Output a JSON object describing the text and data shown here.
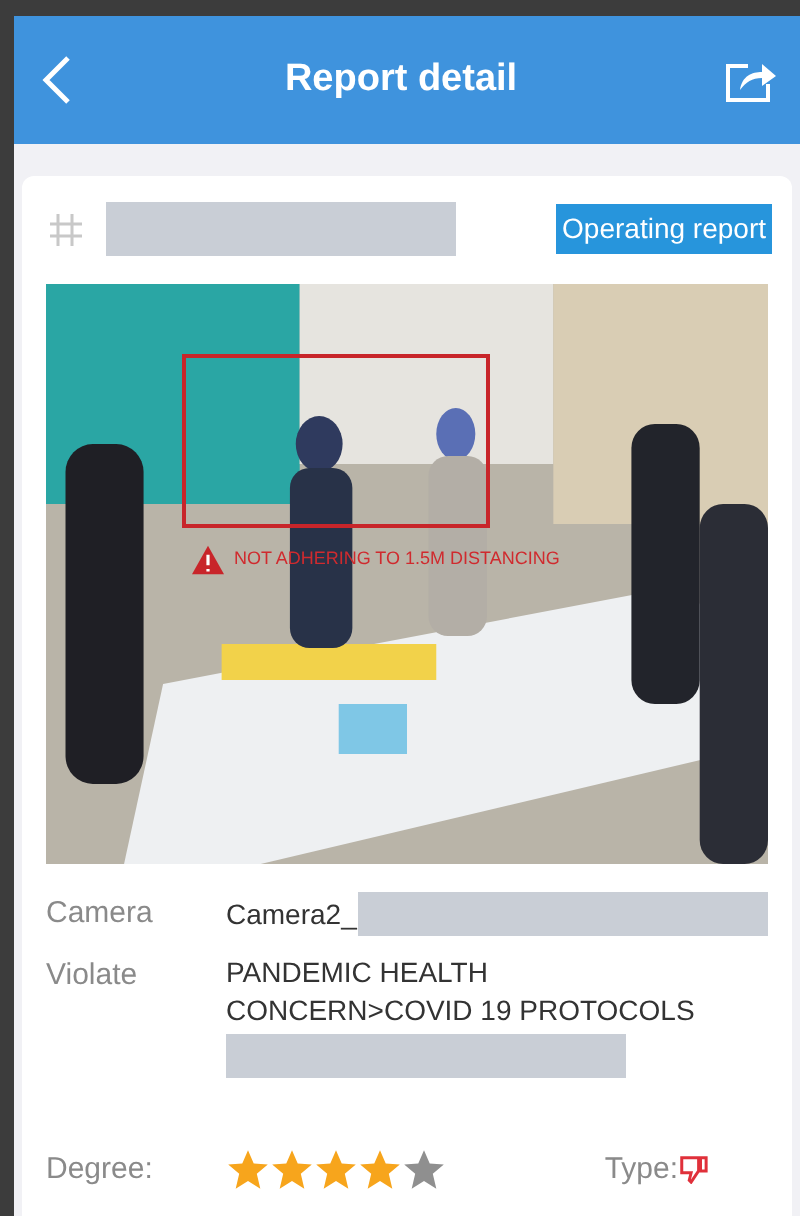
{
  "header": {
    "title": "Report detail"
  },
  "report": {
    "badge": "Operating report"
  },
  "snapshot": {
    "kind": "picture",
    "alert": "NOT ADHERING TO 1.5M DISTANCING"
  },
  "details": [
    {
      "label": "Camera",
      "value": "Camera2_",
      "redacted": true
    },
    {
      "label": "Violate",
      "value": "PANDEMIC HEALTH CONCERN>COVID 19 PROTOCOLS",
      "redacted": true
    }
  ],
  "degree": {
    "label": "Degree:",
    "stars": 4
  },
  "type": {
    "label": "Type:"
  }
}
